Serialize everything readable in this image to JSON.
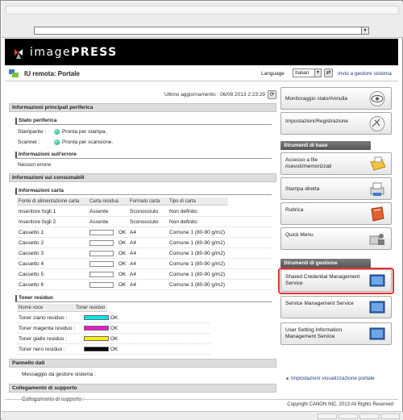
{
  "brand": {
    "logo_text_light": "image",
    "logo_text_bold": "PRESS",
    "page_title": "IU remota: Portale"
  },
  "language": {
    "label": "Language",
    "selected": "Italian",
    "admin_link": "Invio a gestore sistema"
  },
  "last_update": "Ultimo aggiornamento : 06/08 2013 2:23:29",
  "device_info": {
    "header": "Informazioni principali periferica",
    "status_header": "Stato periferica",
    "printer_label": "Stampante :",
    "printer_status": "Pronta per stampa.",
    "scanner_label": "Scanner :",
    "scanner_status": "Pronta per scansione.",
    "error_header": "Informazioni sull'errore",
    "error_text": "Nessun errore"
  },
  "consumables": {
    "header": "Informazioni sui consumabili",
    "paper_header": "Informazioni carta",
    "columns": [
      "Fonte di alimentazione carta",
      "Carta residua",
      "Formato carta",
      "Tipo di carta"
    ],
    "rows": [
      {
        "source": "Inseritore fogli 1",
        "remaining": "Assente",
        "size": "Sconosciuto",
        "type": "Non definito",
        "bar": false
      },
      {
        "source": "Inseritore fogli 2",
        "remaining": "Assente",
        "size": "Sconosciuto",
        "type": "Non definito",
        "bar": false
      },
      {
        "source": "Cassetto 1",
        "remaining": "OK",
        "size": "A4",
        "type": "Comune 1 (80-90 g/m2)",
        "bar": true
      },
      {
        "source": "Cassetto 2",
        "remaining": "OK",
        "size": "A4",
        "type": "Comune 1 (80-90 g/m2)",
        "bar": true
      },
      {
        "source": "Cassetto 3",
        "remaining": "OK",
        "size": "A4",
        "type": "Comune 1 (80-90 g/m2)",
        "bar": true
      },
      {
        "source": "Cassetto 4",
        "remaining": "OK",
        "size": "A4",
        "type": "Comune 1 (80-90 g/m2)",
        "bar": true
      },
      {
        "source": "Cassetto 5",
        "remaining": "OK",
        "size": "A4",
        "type": "Comune 1 (80-90 g/m2)",
        "bar": true
      },
      {
        "source": "Cassetto 6",
        "remaining": "OK",
        "size": "A4",
        "type": "Comune 1 (80-90 g/m2)",
        "bar": true
      }
    ],
    "toner_header": "Toner residuo",
    "toner_columns": [
      "Nome voce",
      "Toner residuo"
    ],
    "toners": [
      {
        "name": "Toner ciano residuo :",
        "status": "OK",
        "color": "#00e5ef"
      },
      {
        "name": "Toner magenta residuo :",
        "status": "OK",
        "color": "#e81cc9"
      },
      {
        "name": "Toner giallo residuo :",
        "status": "OK",
        "color": "#fff000"
      },
      {
        "name": "Toner nero residuo :",
        "status": "OK",
        "color": "#000000"
      }
    ]
  },
  "panel": {
    "header": "Pannello dati",
    "message": "Messaggio da gestore sistema :"
  },
  "support": {
    "header": "Collegamento di supporto",
    "text": "Collegamento di supporto :"
  },
  "right_panel": {
    "top_buttons": [
      {
        "label": "Monitoraggio stato/Annulla",
        "icon": "eye-icon"
      },
      {
        "label": "Impostazioni/Registrazione",
        "icon": "settings-icon"
      }
    ],
    "basic_header": "Strumenti di base",
    "basic_buttons": [
      {
        "label": "Accesso a file ricevuti/memorizzati",
        "icon": "folder-icon"
      },
      {
        "label": "Stampa diretta",
        "icon": "printer-icon"
      },
      {
        "label": "Rubrica",
        "icon": "address-book-icon"
      },
      {
        "label": "Quick Menu",
        "icon": "quick-menu-icon"
      }
    ],
    "mgmt_header": "Strumenti di gestione",
    "mgmt_buttons": [
      {
        "label": "Shared Credential Management Service",
        "icon": "monitor-icon"
      },
      {
        "label": "Service Management Service",
        "icon": "monitor-icon"
      },
      {
        "label": "User Setting Information Management Service",
        "icon": "monitor-icon"
      }
    ],
    "settings_link": "Impostazioni visualizzazione portale"
  },
  "footer": {
    "copyright": "Copyright CANON INC. 2013 All Rights Reserved"
  }
}
